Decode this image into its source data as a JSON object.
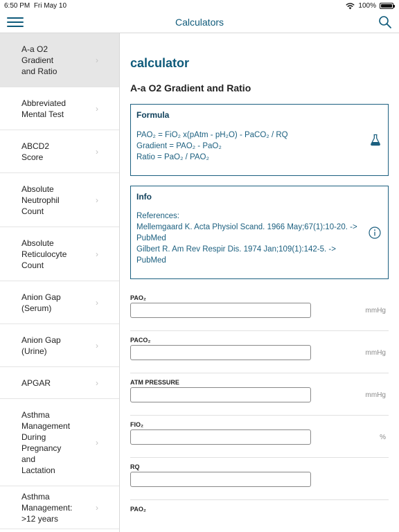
{
  "status": {
    "time": "6:50 PM",
    "date": "Fri May 10",
    "battery": "100%"
  },
  "nav": {
    "title": "Calculators",
    "menu_icon": "hamburger-menu-icon",
    "search_icon": "search-icon"
  },
  "sidebar": {
    "items": [
      {
        "lines": [
          "A-a O2",
          "Gradient",
          "and Ratio"
        ],
        "selected": true
      },
      {
        "lines": [
          "Abbreviated",
          "Mental Test"
        ]
      },
      {
        "lines": [
          "ABCD2",
          "Score"
        ]
      },
      {
        "lines": [
          "Absolute",
          "Neutrophil",
          "Count"
        ]
      },
      {
        "lines": [
          "Absolute",
          "Reticulocyte",
          "Count"
        ]
      },
      {
        "lines": [
          "Anion Gap",
          "(Serum)"
        ]
      },
      {
        "lines": [
          "Anion Gap",
          "(Urine)"
        ]
      },
      {
        "lines": [
          "APGAR"
        ]
      },
      {
        "lines": [
          "Asthma",
          "Management",
          "During",
          "Pregnancy",
          "and",
          "Lactation"
        ]
      },
      {
        "lines": [
          "Asthma",
          "Management:",
          ">12 years"
        ]
      }
    ]
  },
  "main": {
    "section_title": "calculator",
    "calc_name": "A-a O2 Gradient and Ratio",
    "formula": {
      "title": "Formula",
      "icon": "flask-icon",
      "lines": [
        "PAO₂ = FiO₂ x(pAtm - pH₂O) - PaCO₂ / RQ",
        "Gradient = PAO₂ - PaO₂",
        "Ratio = PaO₂ / PAO₂"
      ]
    },
    "info": {
      "title": "Info",
      "icon": "info-icon",
      "lines": [
        "References:",
        "Mellemgaard K. Acta Physiol Scand. 1966 May;67(1):10-20. -> PubMed",
        "Gilbert R. Am Rev Respir Dis. 1974 Jan;109(1):142-5. -> PubMed"
      ]
    },
    "fields": [
      {
        "label": "PAO₂",
        "unit": "mmHg",
        "value": ""
      },
      {
        "label": "PACO₂",
        "unit": "mmHg",
        "value": ""
      },
      {
        "label": "ATM PRESSURE",
        "unit": "mmHg",
        "value": ""
      },
      {
        "label": "FIO₂",
        "unit": "%",
        "value": ""
      },
      {
        "label": "RQ",
        "unit": "",
        "value": ""
      },
      {
        "label": "PAO₂",
        "unit": "",
        "value": ""
      }
    ]
  },
  "colors": {
    "accent": "#0e5a7a",
    "box_border": "#1b5f7f",
    "selected_bg": "#e6e6e6"
  }
}
